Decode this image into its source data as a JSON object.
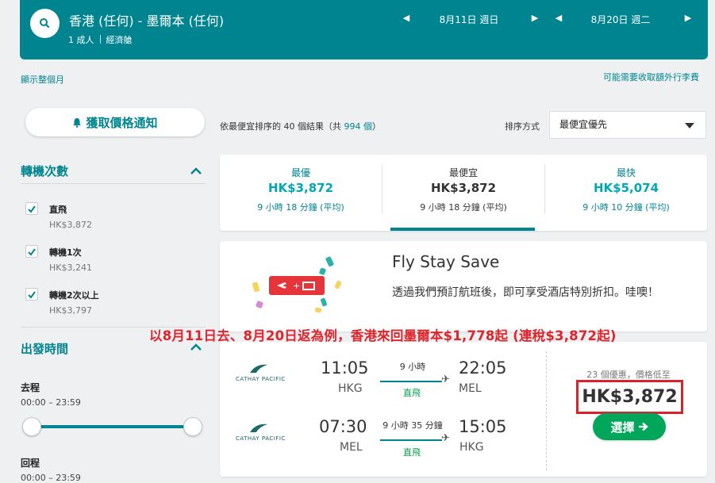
{
  "header": {
    "route": "香港 (任何) - 墨爾本 (任何)",
    "passengers": "1 成人",
    "cabin": "經濟艙",
    "depart_date": "8月11日 週日",
    "return_date": "8月20日 週二"
  },
  "links": {
    "show_month": "顯示整個月",
    "extra_fees": "可能需要收取額外行李費"
  },
  "price_alert": {
    "label": "獲取價格通知"
  },
  "results": {
    "prefix": "依",
    "sort_name": "最便宜",
    "middle": "排序的 40 個結果（共 ",
    "total": "994 個",
    "suffix": "）"
  },
  "sort": {
    "label": "排序方式",
    "value": "最便宜優先"
  },
  "filters": {
    "stops_title": "轉機次數",
    "stops": [
      {
        "label": "直飛",
        "price": "HK$3,872",
        "checked": true
      },
      {
        "label": "轉機1次",
        "price": "HK$3,241",
        "checked": true
      },
      {
        "label": "轉機2次以上",
        "price": "HK$3,797",
        "checked": true
      }
    ],
    "time_title": "出發時間",
    "outbound": {
      "label": "去程",
      "range": "00:00 – 23:59"
    },
    "return": {
      "label": "回程",
      "range": "00:00 – 23:59"
    }
  },
  "summary": [
    {
      "title": "最優",
      "price": "HK$3,872",
      "duration": "9 小時 18 分鐘 (平均)",
      "active": false
    },
    {
      "title": "最便宜",
      "price": "HK$3,872",
      "duration": "9 小時 18 分鐘 (平均)",
      "active": true
    },
    {
      "title": "最快",
      "price": "HK$5,074",
      "duration": "9 小時 10 分鐘 (平均)",
      "active": false
    }
  ],
  "promo": {
    "title": "Fly Stay Save",
    "text": "透過我們預訂航班後，即可享受酒店特別折扣。哇噢！"
  },
  "overlay_caption": "以8月11日去、8月20日返為例，香港來回墨爾本$1,778起 (連稅$3,872起)",
  "flight": {
    "legs": [
      {
        "airline": "CATHAY PACIFIC",
        "dep_time": "11:05",
        "dep_code": "HKG",
        "duration": "9 小時",
        "stops": "直飛",
        "arr_time": "22:05",
        "arr_code": "MEL"
      },
      {
        "airline": "CATHAY PACIFIC",
        "dep_time": "07:30",
        "dep_code": "MEL",
        "duration": "9 小時 35 分鐘",
        "stops": "直飛",
        "arr_time": "15:05",
        "arr_code": "HKG"
      }
    ],
    "deals": "23 個優惠，價格低至",
    "price": "HK$3,872",
    "select_label": "選擇"
  },
  "colors": {
    "brand": "#00848f",
    "highlight": "#e0242c",
    "select": "#00a65a"
  }
}
